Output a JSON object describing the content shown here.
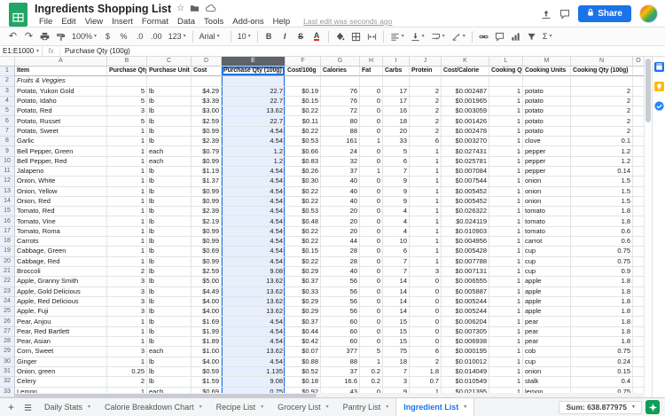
{
  "titlebar": {
    "title": "Ingredients Shopping List",
    "star_icon": "☆",
    "menus": [
      "File",
      "Edit",
      "View",
      "Insert",
      "Format",
      "Data",
      "Tools",
      "Add-ons",
      "Help"
    ],
    "last_edit": "Last edit was seconds ago",
    "share_label": "Share"
  },
  "toolbar": {
    "items": [
      {
        "name": "undo",
        "glyph": "↶"
      },
      {
        "name": "redo",
        "glyph": "↷"
      },
      {
        "name": "print",
        "svg": true
      },
      {
        "name": "paint-format",
        "svg": true
      },
      {
        "name": "zoom",
        "label": "100%",
        "caret": true,
        "wide": true
      },
      {
        "name": "currency-format",
        "label": "$"
      },
      {
        "name": "percent-format",
        "label": "%"
      },
      {
        "name": "decrease-decimals",
        "label": ".0"
      },
      {
        "name": "increase-decimals",
        "label": ".00"
      },
      {
        "name": "more-formats",
        "label": "123",
        "caret": true
      },
      {
        "type": "divider"
      },
      {
        "name": "font-family",
        "label": "Arial",
        "caret": true,
        "wide": true
      },
      {
        "type": "divider"
      },
      {
        "name": "font-size",
        "label": "10",
        "caret": true
      },
      {
        "type": "divider"
      },
      {
        "name": "bold",
        "label": "B",
        "style": "bold"
      },
      {
        "name": "italic",
        "label": "I",
        "style": "italic"
      },
      {
        "name": "strikethrough",
        "label": "S",
        "style": "strike"
      },
      {
        "name": "text-color",
        "label": "A",
        "style": "tcolor"
      },
      {
        "type": "divider"
      },
      {
        "name": "fill-color",
        "svg": true
      },
      {
        "name": "borders",
        "svg": true
      },
      {
        "name": "merge-cells",
        "svg": true
      },
      {
        "type": "divider"
      },
      {
        "name": "horizontal-align",
        "svg": true,
        "caret": true
      },
      {
        "name": "vertical-align",
        "svg": true,
        "caret": true
      },
      {
        "name": "text-wrap",
        "svg": true,
        "caret": true
      },
      {
        "name": "text-rotation",
        "svg": true,
        "caret": true
      },
      {
        "type": "divider"
      },
      {
        "name": "insert-link",
        "svg": true
      },
      {
        "name": "insert-comment",
        "svg": true
      },
      {
        "name": "insert-chart",
        "svg": true
      },
      {
        "name": "filter",
        "svg": true
      },
      {
        "name": "functions",
        "label": "Σ",
        "caret": true
      }
    ]
  },
  "formula_bar": {
    "cell_ref": "E1:E1000",
    "fx_label": "fx",
    "content": "Purchase Qty (100g)"
  },
  "grid": {
    "col_letters": [
      "A",
      "B",
      "C",
      "D",
      "E",
      "F",
      "G",
      "H",
      "I",
      "J",
      "K",
      "L",
      "M",
      "N",
      "O"
    ],
    "selected_col": "E",
    "headers": [
      "Item",
      "Purchase Qty",
      "Purchase Unit",
      "Cost",
      "Purchase Qty (100g)",
      "Cost/100g",
      "Calories",
      "Fat",
      "Carbs",
      "Protein",
      "Cost/Calorie",
      "Cooking Qty",
      "Cooking Units",
      "Cooking Qty (100g)"
    ],
    "section_label": "Fruits & Veggies",
    "first_data_row_number": 3,
    "rows": [
      [
        "Potato, Yukon Gold",
        "5",
        "lb",
        "$4.29",
        "22.7",
        "$0.19",
        "76",
        "0",
        "17",
        "2",
        "$0.002487",
        "1",
        "potato",
        "2"
      ],
      [
        "Potato, Idaho",
        "5",
        "lb",
        "$3.39",
        "22.7",
        "$0.15",
        "76",
        "0",
        "17",
        "2",
        "$0.001965",
        "1",
        "potato",
        "2"
      ],
      [
        "Potato, Red",
        "3",
        "lb",
        "$3.00",
        "13.62",
        "$0.22",
        "72",
        "0",
        "16",
        "2",
        "$0.003059",
        "1",
        "potato",
        "2"
      ],
      [
        "Potato, Russet",
        "5",
        "lb",
        "$2.59",
        "22.7",
        "$0.11",
        "80",
        "0",
        "18",
        "2",
        "$0.001426",
        "1",
        "potato",
        "2"
      ],
      [
        "Potato, Sweet",
        "1",
        "lb",
        "$0.99",
        "4.54",
        "$0.22",
        "88",
        "0",
        "20",
        "2",
        "$0.002478",
        "1",
        "potato",
        "2"
      ],
      [
        "Garlic",
        "1",
        "lb",
        "$2.39",
        "4.54",
        "$0.53",
        "161",
        "1",
        "33",
        "6",
        "$0.003270",
        "1",
        "clove",
        "0.1"
      ],
      [
        "Bell Pepper, Green",
        "1",
        "each",
        "$0.79",
        "1.2",
        "$0.66",
        "24",
        "0",
        "5",
        "1",
        "$0.027431",
        "1",
        "pepper",
        "1.2"
      ],
      [
        "Bell Pepper, Red",
        "1",
        "each",
        "$0.99",
        "1.2",
        "$0.83",
        "32",
        "0",
        "6",
        "1",
        "$0.025781",
        "1",
        "pepper",
        "1.2"
      ],
      [
        "Jalapeno",
        "1",
        "lb",
        "$1.19",
        "4.54",
        "$0.26",
        "37",
        "1",
        "7",
        "1",
        "$0.007084",
        "1",
        "pepper",
        "0.14"
      ],
      [
        "Onion, White",
        "1",
        "lb",
        "$1.37",
        "4.54",
        "$0.30",
        "40",
        "0",
        "9",
        "1",
        "$0.007544",
        "1",
        "onion",
        "1.5"
      ],
      [
        "Onion, Yellow",
        "1",
        "lb",
        "$0.99",
        "4.54",
        "$0.22",
        "40",
        "0",
        "9",
        "1",
        "$0.005452",
        "1",
        "onion",
        "1.5"
      ],
      [
        "Onion, Red",
        "1",
        "lb",
        "$0.99",
        "4.54",
        "$0.22",
        "40",
        "0",
        "9",
        "1",
        "$0.005452",
        "1",
        "onion",
        "1.5"
      ],
      [
        "Tomato, Red",
        "1",
        "lb",
        "$2.39",
        "4.54",
        "$0.53",
        "20",
        "0",
        "4",
        "1",
        "$0.026322",
        "1",
        "tomato",
        "1.8"
      ],
      [
        "Tomato, Vine",
        "1",
        "lb",
        "$2.19",
        "4.54",
        "$0.48",
        "20",
        "0",
        "4",
        "1",
        "$0.024119",
        "1",
        "tomato",
        "1.8"
      ],
      [
        "Tomato, Roma",
        "1",
        "lb",
        "$0.99",
        "4.54",
        "$0.22",
        "20",
        "0",
        "4",
        "1",
        "$0.010903",
        "1",
        "tomato",
        "0.6"
      ],
      [
        "Carrots",
        "1",
        "lb",
        "$0.99",
        "4.54",
        "$0.22",
        "44",
        "0",
        "10",
        "1",
        "$0.004956",
        "1",
        "carrot",
        "0.6"
      ],
      [
        "Cabbage, Green",
        "1",
        "lb",
        "$0.69",
        "4.54",
        "$0.15",
        "28",
        "0",
        "6",
        "1",
        "$0.005428",
        "1",
        "cup",
        "0.75"
      ],
      [
        "Cabbage, Red",
        "1",
        "lb",
        "$0.99",
        "4.54",
        "$0.22",
        "28",
        "0",
        "7",
        "1",
        "$0.007788",
        "1",
        "cup",
        "0.75"
      ],
      [
        "Broccoli",
        "2",
        "lb",
        "$2.59",
        "9.08",
        "$0.29",
        "40",
        "0",
        "7",
        "3",
        "$0.007131",
        "1",
        "cup",
        "0.9"
      ],
      [
        "Apple, Granny Smith",
        "3",
        "lb",
        "$5.00",
        "13.62",
        "$0.37",
        "56",
        "0",
        "14",
        "0",
        "$0.006555",
        "1",
        "apple",
        "1.8"
      ],
      [
        "Apple, Gold Delicious",
        "3",
        "lb",
        "$4.49",
        "13.62",
        "$0.33",
        "56",
        "0",
        "14",
        "0",
        "$0.005887",
        "1",
        "apple",
        "1.8"
      ],
      [
        "Apple, Red Delicious",
        "3",
        "lb",
        "$4.00",
        "13.62",
        "$0.29",
        "56",
        "0",
        "14",
        "0",
        "$0.005244",
        "1",
        "apple",
        "1.8"
      ],
      [
        "Apple, Fuji",
        "3",
        "lb",
        "$4.00",
        "13.62",
        "$0.29",
        "56",
        "0",
        "14",
        "0",
        "$0.005244",
        "1",
        "apple",
        "1.8"
      ],
      [
        "Pear, Anjou",
        "1",
        "lb",
        "$1.69",
        "4.54",
        "$0.37",
        "60",
        "0",
        "15",
        "0",
        "$0.006204",
        "1",
        "pear",
        "1.8"
      ],
      [
        "Pear, Red Bartlett",
        "1",
        "lb",
        "$1.99",
        "4.54",
        "$0.44",
        "60",
        "0",
        "15",
        "0",
        "$0.007305",
        "1",
        "pear",
        "1.8"
      ],
      [
        "Pear, Asian",
        "1",
        "lb",
        "$1.89",
        "4.54",
        "$0.42",
        "60",
        "0",
        "15",
        "0",
        "$0.006938",
        "1",
        "pear",
        "1.8"
      ],
      [
        "Corn, Sweet",
        "3",
        "each",
        "$1.00",
        "13.62",
        "$0.07",
        "377",
        "5",
        "75",
        "6",
        "$0.000195",
        "1",
        "cob",
        "0.75"
      ],
      [
        "Ginger",
        "1",
        "lb",
        "$4.00",
        "4.54",
        "$0.88",
        "88",
        "1",
        "18",
        "2",
        "$0.010012",
        "1",
        "cup",
        "0.24"
      ],
      [
        "Onion, green",
        "0.25",
        "lb",
        "$0.59",
        "1.135",
        "$0.52",
        "37",
        "0.2",
        "7",
        "1.8",
        "$0.014049",
        "1",
        "onion",
        "0.15"
      ],
      [
        "Celery",
        "2",
        "lb",
        "$1.59",
        "9.08",
        "$0.18",
        "16.6",
        "0.2",
        "3",
        "0.7",
        "$0.010549",
        "1",
        "stalk",
        "0.4"
      ],
      [
        "Lemon",
        "1",
        "each",
        "$0.69",
        "0.75",
        "$0.92",
        "43",
        "0",
        "9",
        "1",
        "$0.021395",
        "1",
        "lemon",
        "0.75"
      ]
    ]
  },
  "sheet_tabs": [
    "Daily Stats",
    "Calorie Breakdown Chart",
    "Recipe List",
    "Grocery List",
    "Pantry List",
    "Ingredient List"
  ],
  "active_tab": "Ingredient List",
  "tabbar": {
    "add_sheet": "+"
  },
  "status": {
    "sum": "Sum: 638.877975"
  },
  "side_panel": [
    "calendar",
    "keep",
    "tasks"
  ],
  "colors": {
    "accent": "#1a73e8",
    "selection_fill": "#e7effd",
    "selected_header": "#5f6368",
    "logo_green": "#23a566",
    "share_button": "#1a73e8",
    "explore_green": "#0f9d58",
    "keep_yellow": "#fbbc04",
    "tasks_blue": "#2684fc",
    "calendar_blue": "#1a73e8"
  }
}
